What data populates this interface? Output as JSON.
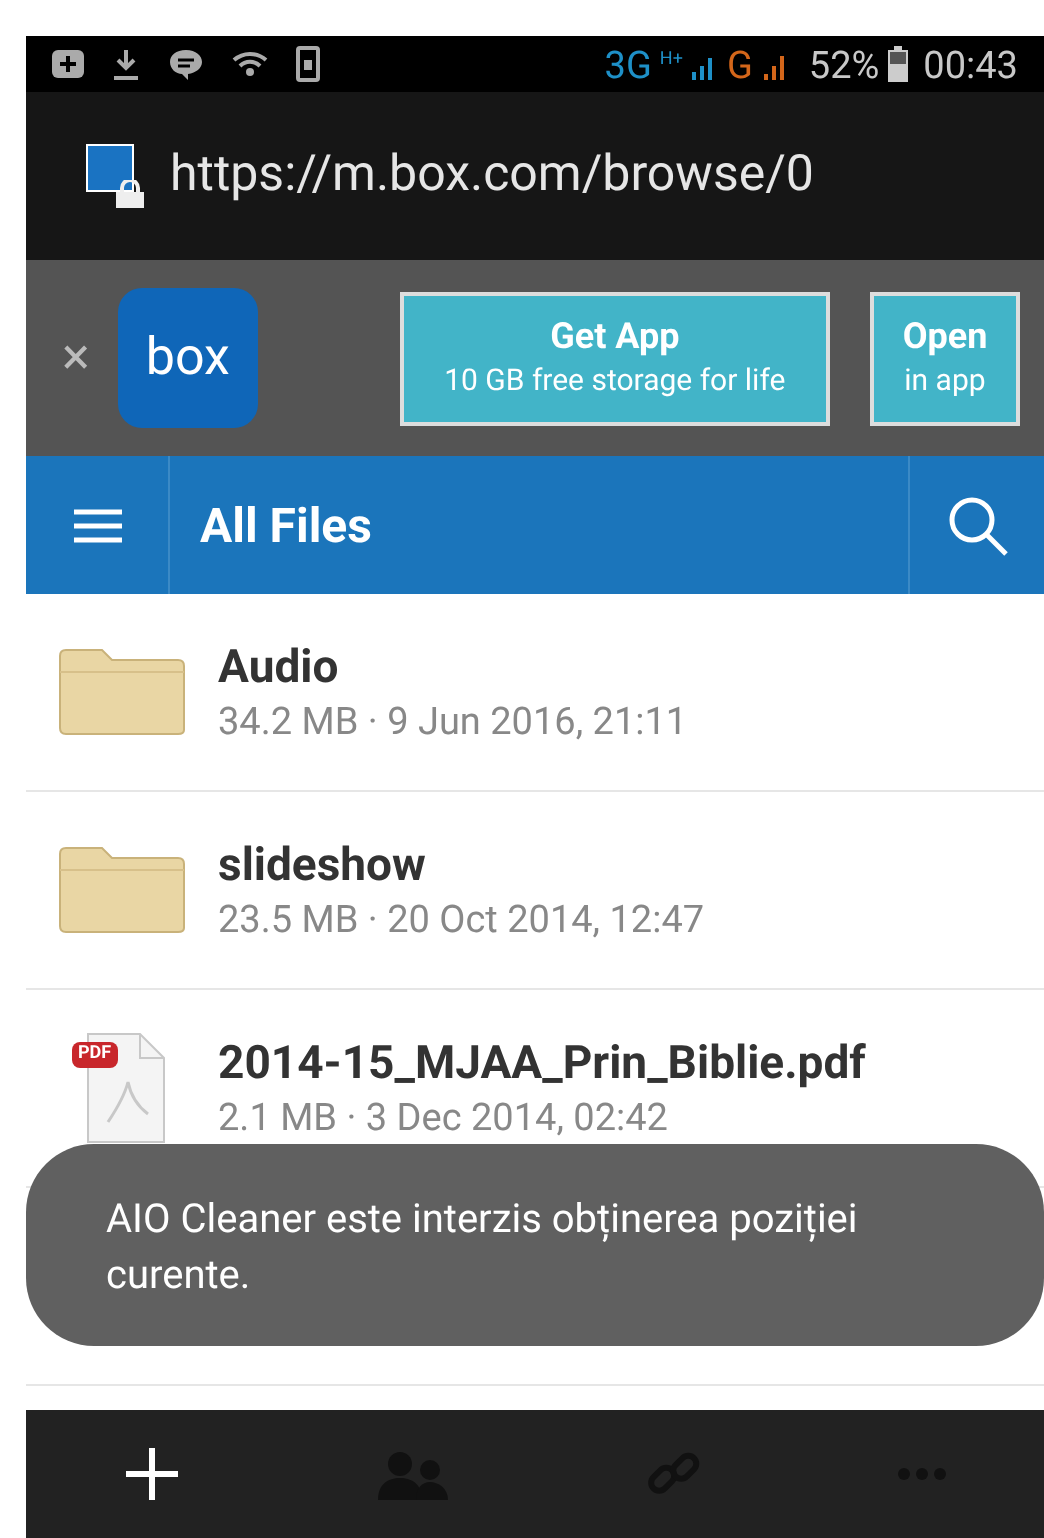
{
  "status_bar": {
    "network_3g": "3G",
    "network_hplus": "H+",
    "network_g": "G",
    "battery": "52%",
    "time": "00:43"
  },
  "address_bar": {
    "url": "https://m.box.com/browse/0"
  },
  "app_banner": {
    "close": "×",
    "logo": "box",
    "get_app": {
      "title": "Get App",
      "subtitle": "10 GB free storage for life"
    },
    "open": {
      "title": "Open",
      "subtitle": "in app"
    }
  },
  "nav": {
    "title": "All Files"
  },
  "files": [
    {
      "kind": "folder",
      "name": "Audio",
      "meta": "34.2 MB · 9 Jun 2016, 21:11"
    },
    {
      "kind": "folder",
      "name": "slideshow",
      "meta": "23.5 MB · 20 Oct 2014, 12:47"
    },
    {
      "kind": "pdf",
      "name": "2014-15_MJAA_Prin_Biblie.pdf",
      "meta": "2.1 MB · 3 Dec 2014, 02:42",
      "badge": "PDF"
    }
  ],
  "toast": {
    "message": "AIO Cleaner este interzis obținerea poziției curente."
  }
}
